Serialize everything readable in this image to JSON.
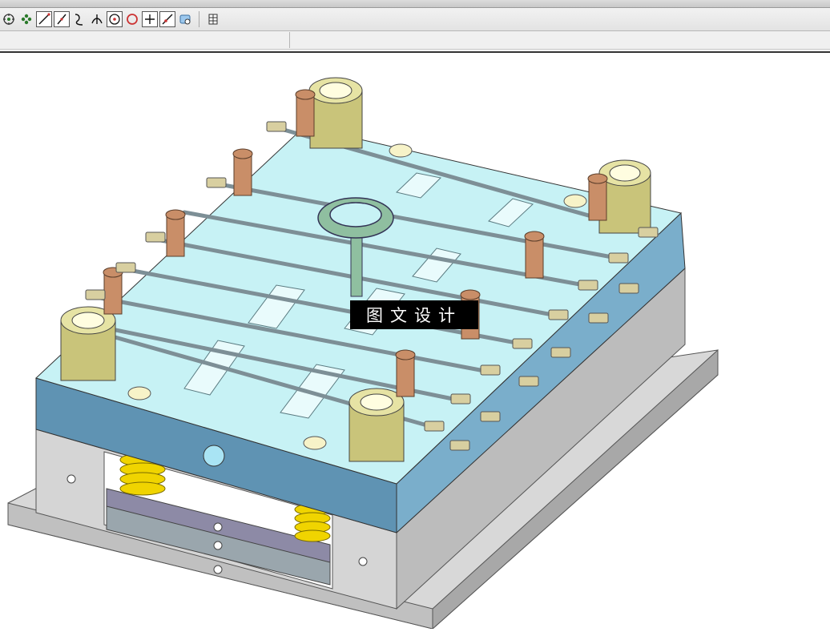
{
  "toolbar": {
    "buttons": [
      {
        "icon": "snap-point-icon",
        "boxed": false
      },
      {
        "icon": "snap-grid-icon",
        "boxed": false
      },
      {
        "icon": "line-icon",
        "boxed": true
      },
      {
        "icon": "slash-line-icon",
        "boxed": true
      },
      {
        "icon": "curve-icon",
        "boxed": false
      },
      {
        "icon": "intersection-icon",
        "boxed": false
      },
      {
        "icon": "circle-center-icon",
        "boxed": true
      },
      {
        "icon": "quadrant-point-icon",
        "boxed": false
      },
      {
        "icon": "crosshair-icon",
        "boxed": true
      },
      {
        "icon": "tangent-icon",
        "boxed": true
      },
      {
        "icon": "existing-point-icon",
        "boxed": false
      },
      {
        "icon": "grid-table-icon",
        "boxed": false
      }
    ]
  },
  "viewport": {
    "model": "injection-mold-assembly",
    "colors": {
      "plate_top": "#c7f2f5",
      "plate_side": "#5f93b3",
      "plate_right": "#7aaecb",
      "base_gray": "#dcdcdc",
      "bushing": "#c9c47a",
      "screw": "#c98e68",
      "spring": "#f0d400",
      "ring": "#8fbfa0"
    }
  },
  "watermark": {
    "text": "图文设计"
  }
}
